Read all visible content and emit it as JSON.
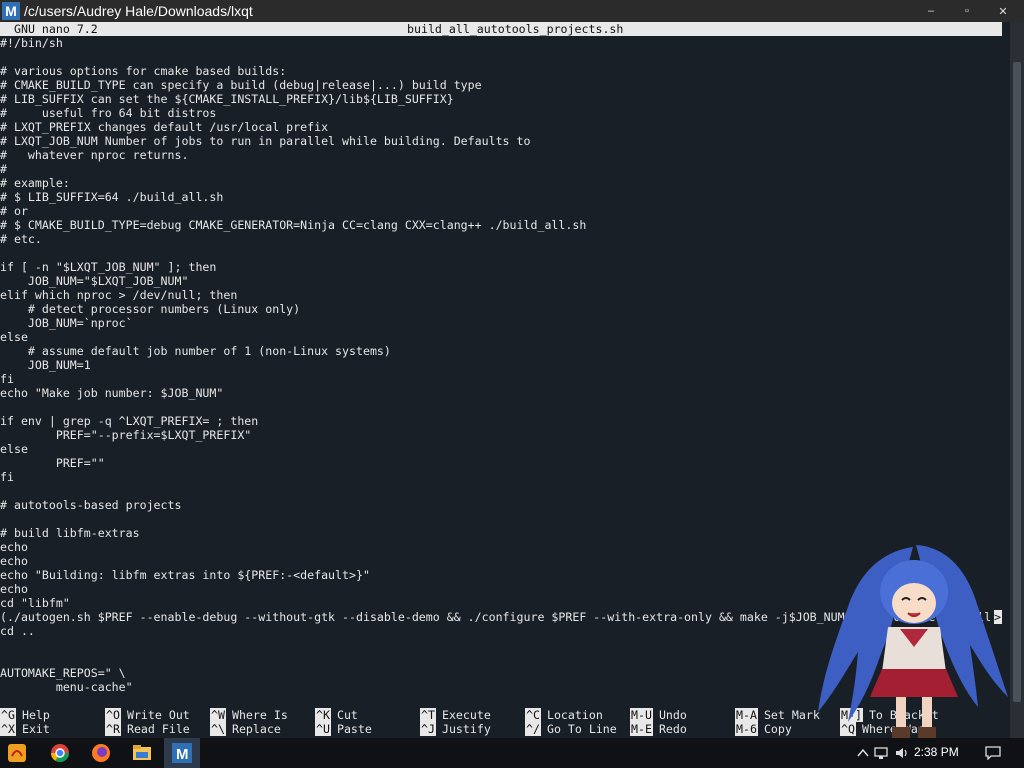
{
  "window": {
    "title": "/c/users/Audrey Hale/Downloads/lxqt",
    "app_icon_letter": "M",
    "minimize": "–",
    "maximize": "▫",
    "close": "✕"
  },
  "nano": {
    "version": "GNU nano 7.2",
    "filename": "build_all_autotools_projects.sh",
    "cursor_overflow": ">"
  },
  "lines": [
    "#!/bin/sh",
    "",
    "# various options for cmake based builds:",
    "# CMAKE_BUILD_TYPE can specify a build (debug|release|...) build type",
    "# LIB_SUFFIX can set the ${CMAKE_INSTALL_PREFIX}/lib${LIB_SUFFIX}",
    "#     useful fro 64 bit distros",
    "# LXQT_PREFIX changes default /usr/local prefix",
    "# LXQT_JOB_NUM Number of jobs to run in parallel while building. Defaults to",
    "#   whatever nproc returns.",
    "#",
    "# example:",
    "# $ LIB_SUFFIX=64 ./build_all.sh",
    "# or",
    "# $ CMAKE_BUILD_TYPE=debug CMAKE_GENERATOR=Ninja CC=clang CXX=clang++ ./build_all.sh",
    "# etc.",
    "",
    "if [ -n \"$LXQT_JOB_NUM\" ]; then",
    "    JOB_NUM=\"$LXQT_JOB_NUM\"",
    "elif which nproc > /dev/null; then",
    "    # detect processor numbers (Linux only)",
    "    JOB_NUM=`nproc`",
    "else",
    "    # assume default job number of 1 (non-Linux systems)",
    "    JOB_NUM=1",
    "fi",
    "echo \"Make job number: $JOB_NUM\"",
    "",
    "if env | grep -q ^LXQT_PREFIX= ; then",
    "        PREF=\"--prefix=$LXQT_PREFIX\"",
    "else",
    "        PREF=\"\"",
    "fi",
    "",
    "# autotools-based projects",
    "",
    "# build libfm-extras",
    "echo",
    "echo",
    "echo \"Building: libfm extras into ${PREF:-<default>}\"",
    "echo",
    "cd \"libfm\"",
    "(./autogen.sh $PREF --enable-debug --without-gtk --disable-demo && ./configure $PREF --with-extra-only && make -j$JOB_NUM && sudo make install",
    "cd ..",
    "",
    "",
    "AUTOMAKE_REPOS=\" \\",
    "        menu-cache\""
  ],
  "shortcuts": [
    {
      "key": "^G",
      "label": "Help"
    },
    {
      "key": "^X",
      "label": "Exit"
    },
    {
      "key": "^O",
      "label": "Write Out"
    },
    {
      "key": "^R",
      "label": "Read File"
    },
    {
      "key": "^W",
      "label": "Where Is"
    },
    {
      "key": "^\\",
      "label": "Replace"
    },
    {
      "key": "^K",
      "label": "Cut"
    },
    {
      "key": "^U",
      "label": "Paste"
    },
    {
      "key": "^T",
      "label": "Execute"
    },
    {
      "key": "^J",
      "label": "Justify"
    },
    {
      "key": "^C",
      "label": "Location"
    },
    {
      "key": "^/",
      "label": "Go To Line"
    },
    {
      "key": "M-U",
      "label": "Undo"
    },
    {
      "key": "M-E",
      "label": "Redo"
    },
    {
      "key": "M-A",
      "label": "Set Mark"
    },
    {
      "key": "M-6",
      "label": "Copy"
    },
    {
      "key": "M-]",
      "label": "To Bracket"
    },
    {
      "key": "^Q",
      "label": "Where Was"
    }
  ],
  "taskbar": {
    "time": "2:38 PM",
    "icons": [
      "start-icon",
      "chrome-icon",
      "firefox-icon",
      "file-explorer-icon",
      "mobaxterm-icon"
    ],
    "tray_icons": [
      "chevron-up-icon",
      "network-icon",
      "volume-icon",
      "notification-icon"
    ]
  },
  "colors": {
    "terminal_text": "#e6e6e6",
    "inverse_bar": "#e8e8e8",
    "terminal_bg": "#181e26",
    "taskbar_bg": "#0f1115"
  }
}
